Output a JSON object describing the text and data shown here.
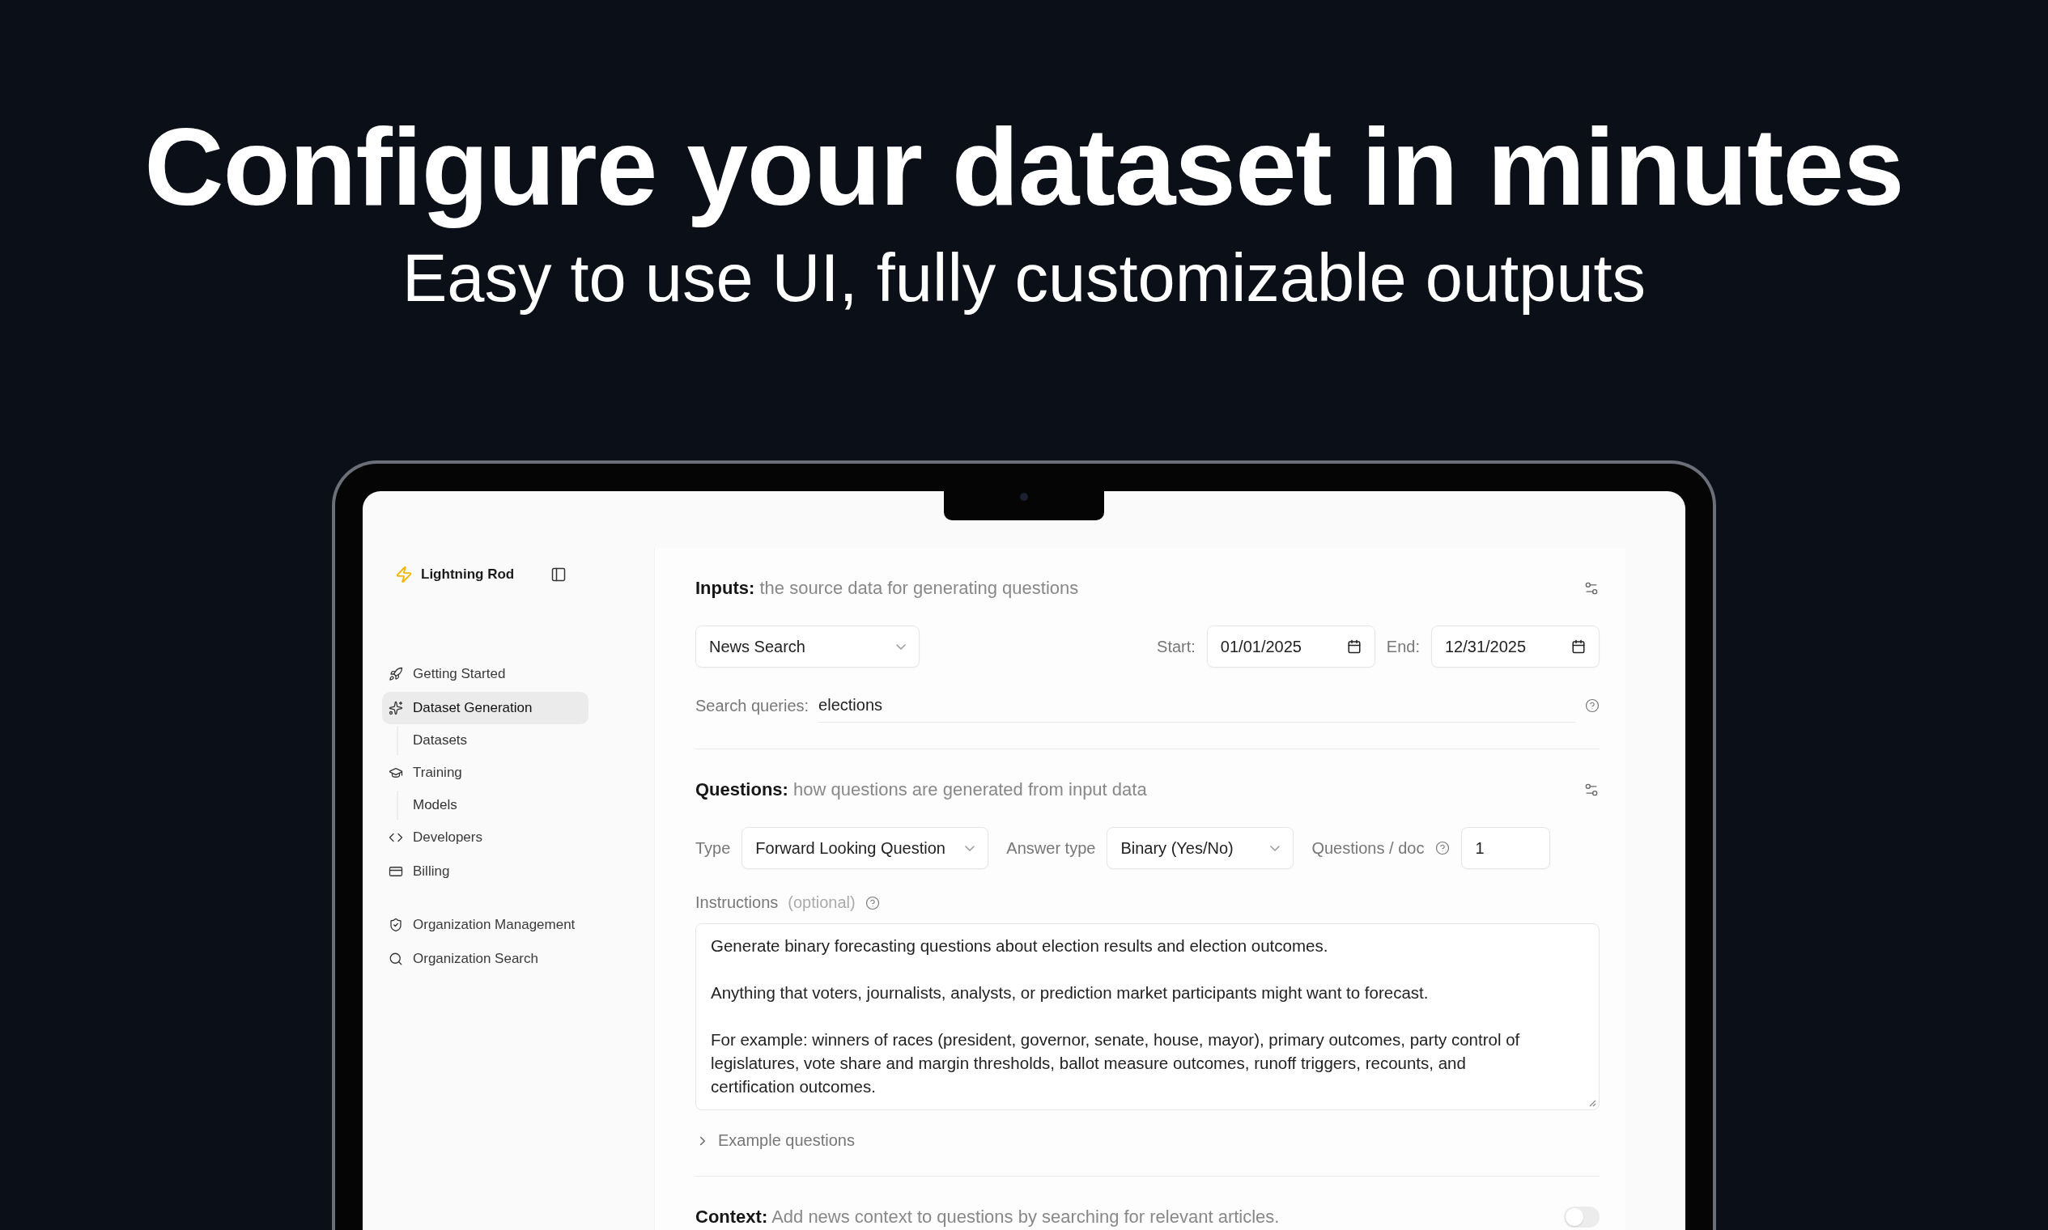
{
  "headline": "Configure your dataset in minutes",
  "subheadline": "Easy to use UI, fully customizable outputs",
  "sidebar": {
    "brand": "Lightning Rod",
    "groups": [
      {
        "items": [
          {
            "label": "Getting Started",
            "selected": false
          },
          {
            "label": "Dataset Generation",
            "selected": true,
            "children": [
              {
                "label": "Datasets",
                "selected": false
              }
            ]
          },
          {
            "label": "Training",
            "selected": false,
            "children": [
              {
                "label": "Models",
                "selected": false
              }
            ]
          },
          {
            "label": "Developers",
            "selected": false
          },
          {
            "label": "Billing",
            "selected": false
          }
        ]
      },
      {
        "items": [
          {
            "label": "Organization Management",
            "selected": false
          },
          {
            "label": "Organization Search",
            "selected": false
          }
        ]
      }
    ]
  },
  "inputs": {
    "title": "Inputs:",
    "description": "the source data for generating questions",
    "source": "News Search",
    "start": {
      "label": "Start:",
      "value": "01/01/2025"
    },
    "end": {
      "label": "End:",
      "value": "12/31/2025"
    },
    "search": {
      "label": "Search queries:",
      "value": "elections"
    }
  },
  "questions": {
    "title": "Questions:",
    "description": "how questions are generated from input data",
    "type": {
      "label": "Type",
      "value": "Forward Looking Question"
    },
    "answer_type": {
      "label": "Answer type",
      "value": "Binary (Yes/No)"
    },
    "per_doc": {
      "label": "Questions / doc",
      "value": "1"
    },
    "instructions": {
      "label": "Instructions",
      "hint": "(optional)",
      "value": "Generate binary forecasting questions about election results and election outcomes.\n\nAnything that voters, journalists, analysts, or prediction market participants might want to forecast.\n\nFor example: winners of races (president, governor, senate, house, mayor), primary outcomes, party control of legislatures, vote share and margin thresholds, ballot measure outcomes, runoff triggers, recounts, and certification outcomes."
    },
    "examples": {
      "label": "Example questions",
      "expanded": false
    }
  },
  "context": {
    "title": "Context:",
    "description": "Add news context to questions by searching for relevant articles.",
    "on": false
  }
}
